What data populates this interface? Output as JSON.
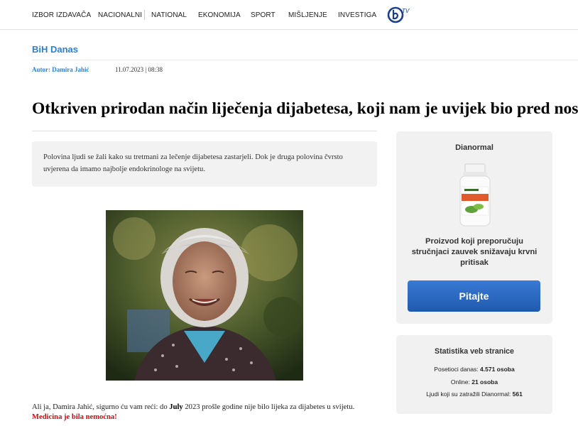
{
  "nav": {
    "items": [
      "IZBOR IZDAVAČA",
      "NACIONALNI",
      "NATIONAL",
      "EKONOMIJA",
      "SPORT",
      "MIŠLJENJE",
      "INVESTIGA"
    ],
    "logo_text": "TV"
  },
  "section": {
    "title": "BiH Danas"
  },
  "byline": {
    "author": "Autor: Damira Jahić",
    "datetime": "11.07.2023 | 08:38"
  },
  "article": {
    "headline": "Otkriven prirodan način liječenja dijabetesa, koji nam je uvijek bio pred nosom!",
    "lead": "Polovina ljudi se žali kako su tretmani za lečenje dijabetesa zastarjeli. Dok je druga polovina čvrsto uvjerena da imamo najbolje endokrinologe na svijetu.",
    "body_prefix": "Ali ja, Damira Jahić, sigurno ću vam reći: do ",
    "body_bold": "July",
    "body_suffix": " 2023 prošle godine nije bilo lijeka za dijabetes u svijetu.",
    "body_red": "Medicina je bila nemoćna!"
  },
  "promo": {
    "product_name": "Dianormal",
    "description": "Proizvod koji preporučuju stručnjaci zauvek snižavaju krvni pritisak",
    "button_label": "Pitajte"
  },
  "stats": {
    "title": "Statistika veb stranice",
    "visitors_label": "Posetioci danas: ",
    "visitors_value": "4.571 osoba",
    "online_label": "Online: ",
    "online_value": "21 osoba",
    "requested_label": "Ljudi koji su zatražili Dianormal: ",
    "requested_value": "561"
  },
  "colors": {
    "accent": "#2a7fd4",
    "button": "#2a66c0",
    "alert": "#cc1111",
    "panel": "#f1f1f1"
  }
}
